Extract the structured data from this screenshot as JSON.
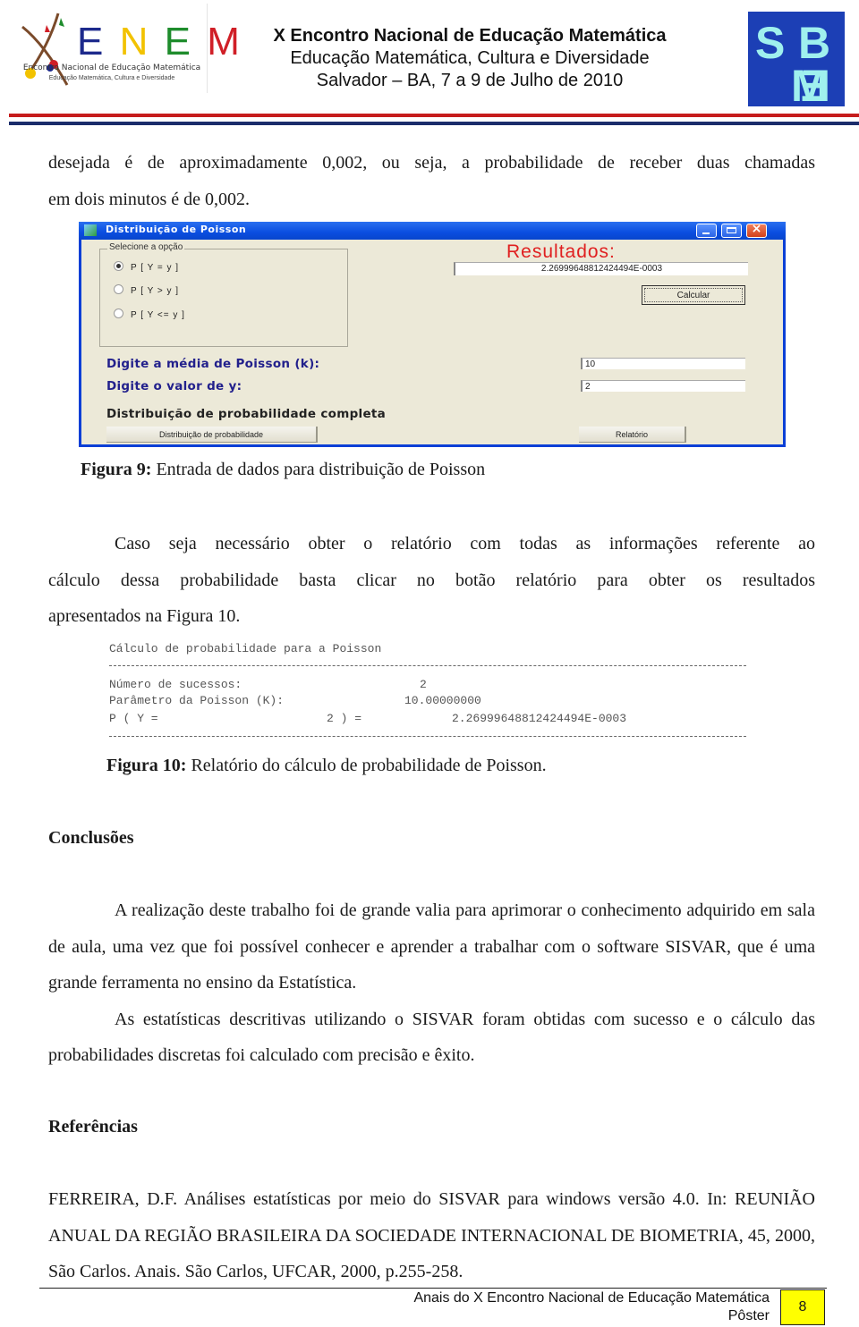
{
  "header": {
    "enem_logo": {
      "letters": [
        "E",
        "N",
        "E",
        "M"
      ],
      "letter_colors": [
        "#1d2a8c",
        "#f2c200",
        "#1e8c2c",
        "#d01f27"
      ],
      "subtitle": "Encontro Nacional de Educação Matemática",
      "tagline": "Educação Matemática, Cultura e Diversidade"
    },
    "title_line1": "X Encontro Nacional de Educação Matemática",
    "title_line2": "Educação Matemática, Cultura e Diversidade",
    "title_line3": "Salvador – BA, 7 a 9 de Julho de 2010",
    "sbem_logo": {
      "text": "SBEM",
      "color": "#1c3fb5",
      "accent": "#9ff0ee"
    }
  },
  "body": {
    "para_intro_line1": "desejada é de aproximadamente 0,002, ou seja, a probabilidade de receber duas chamadas",
    "para_intro_line2": "em dois minutos é de 0,002.",
    "figure9": {
      "window_title": "Distribuição de Poisson",
      "group_label": "Selecione a opção",
      "options": [
        {
          "label": "P [ Y = y ]",
          "selected": true
        },
        {
          "label": "P [ Y > y ]",
          "selected": false
        },
        {
          "label": "P [ Y <= y ]",
          "selected": false
        }
      ],
      "results_label": "Resultados:",
      "result_value": "2.26999648812424494E-0003",
      "calc_button": "Calcular",
      "mean_label": "Digite a média de Poisson (k):",
      "mean_value": "10",
      "y_label": "Digite o valor de y:",
      "y_value": "2",
      "dist_label": "Distribuição de probabilidade completa",
      "dist_button": "Distribuição de probabilidade",
      "report_button": "Relatório",
      "caption_bold": "Figura 9:",
      "caption_text": " Entrada de dados para distribuição de Poisson"
    },
    "para_report": {
      "line1": "Caso seja necessário obter o relatório com todas as informações referente ao",
      "line2": "cálculo dessa probabilidade basta clicar no botão relatório para obter os resultados",
      "line3": "apresentados na Figura 10."
    },
    "figure10": {
      "title": "Cálculo de probabilidade para a Poisson",
      "rows": [
        {
          "label": "Número de sucessos:",
          "value": "2"
        },
        {
          "label": "Parâmetro da Poisson (K):",
          "value": "10.00000000"
        },
        {
          "label": "P ( Y =",
          "mid": "2 ) =",
          "value": "2.26999648812424494E-0003"
        }
      ],
      "caption_bold": "Figura 10:",
      "caption_text": " Relatório do cálculo de probabilidade de Poisson."
    },
    "conclusions": {
      "heading": "Conclusões",
      "p1": "A realização deste trabalho foi de grande valia para aprimorar o conhecimento adquirido em sala de aula, uma vez que foi possível conhecer e aprender a trabalhar com o software SISVAR, que é uma grande ferramenta no ensino da Estatística.",
      "p2": "As estatísticas descritivas utilizando o SISVAR foram obtidas com sucesso e o cálculo das probabilidades discretas foi calculado com precisão e êxito."
    },
    "references": {
      "heading": "Referências",
      "ref1": "FERREIRA, D.F. Análises estatísticas por meio do SISVAR para windows versão 4.0. In: REUNIÃO ANUAL DA REGIÃO BRASILEIRA DA SOCIEDADE INTERNACIONAL DE BIOMETRIA, 45, 2000, São Carlos. Anais. São Carlos, UFCAR, 2000, p.255-258."
    }
  },
  "footer": {
    "line1": "Anais do X Encontro Nacional de Educação Matemática",
    "line2": "Pôster",
    "page_number": "8",
    "page_badge_color": "#ffff00"
  }
}
